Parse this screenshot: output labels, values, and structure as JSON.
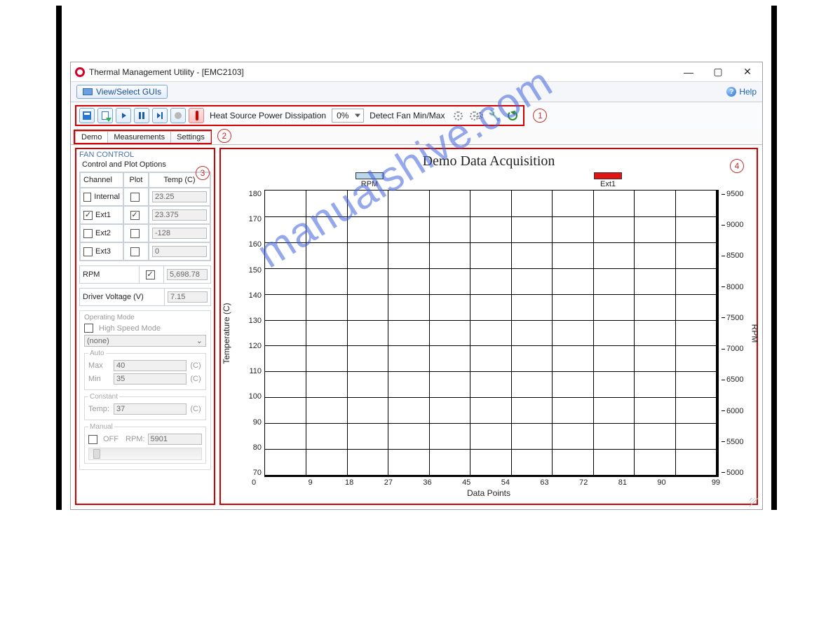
{
  "window": {
    "title": "Thermal Management Utility - [EMC2103]",
    "min": "—",
    "max": "▢",
    "close": "✕"
  },
  "menubar": {
    "view_select": "View/Select GUIs",
    "help": "Help"
  },
  "toolbar": {
    "heat_label": "Heat Source Power Dissipation",
    "heat_value": "0%",
    "detect": "Detect Fan Min/Max"
  },
  "callouts": {
    "c1": "1",
    "c2": "2",
    "c3": "3",
    "c4": "4"
  },
  "tabs": {
    "demo": "Demo",
    "measurements": "Measurements",
    "settings": "Settings"
  },
  "panel": {
    "group": "FAN CONTROL",
    "subtitle": "Control and Plot Options",
    "head_channel": "Channel",
    "head_plot": "Plot",
    "head_temp": "Temp (C)",
    "rows": [
      {
        "name": "Internal",
        "channel_checked": false,
        "plot_checked": false,
        "temp": "23.25"
      },
      {
        "name": "Ext1",
        "channel_checked": true,
        "plot_checked": true,
        "temp": "23.375"
      },
      {
        "name": "Ext2",
        "channel_checked": false,
        "plot_checked": false,
        "temp": "-128"
      },
      {
        "name": "Ext3",
        "channel_checked": false,
        "plot_checked": false,
        "temp": "0"
      }
    ],
    "rpm_label": "RPM",
    "rpm_checked": true,
    "rpm_value": "5,698.78",
    "driver_label": "Driver Voltage (V)",
    "driver_value": "7.15",
    "mode": {
      "group": "Operating Mode",
      "hs_label": "High Speed Mode",
      "dd_value": "(none)",
      "auto": "Auto",
      "auto_max_label": "Max",
      "auto_max": "40",
      "unit": "(C)",
      "auto_min_label": "Min",
      "auto_min": "35",
      "constant": "Constant",
      "const_temp_label": "Temp:",
      "const_temp": "37",
      "manual": "Manual",
      "off_label": "OFF",
      "rpm_label": "RPM:",
      "rpm_val": "5901"
    }
  },
  "chart_data": {
    "type": "line",
    "title": "Demo Data Acquisition",
    "xlabel": "Data Points",
    "ylabel_left": "Temperature (C)",
    "ylabel_right": "RPM",
    "x_ticks": [
      "0",
      "9",
      "18",
      "27",
      "36",
      "45",
      "54",
      "63",
      "72",
      "81",
      "90",
      "99"
    ],
    "y_left_ticks": [
      "180",
      "170",
      "160",
      "150",
      "140",
      "130",
      "120",
      "110",
      "100",
      "90",
      "80",
      "70"
    ],
    "y_right_ticks": [
      "9500",
      "9000",
      "8500",
      "8000",
      "7500",
      "7000",
      "6500",
      "6000",
      "5500",
      "5000"
    ],
    "xlim": [
      0,
      99
    ],
    "ylim_left": [
      70,
      180
    ],
    "ylim_right": [
      5000,
      9500
    ],
    "series": [
      {
        "name": "RPM",
        "color": "#b9d8ee",
        "values": []
      },
      {
        "name": "Ext1",
        "color": "#e21313",
        "values": []
      }
    ]
  },
  "watermark": "manualshive.com"
}
